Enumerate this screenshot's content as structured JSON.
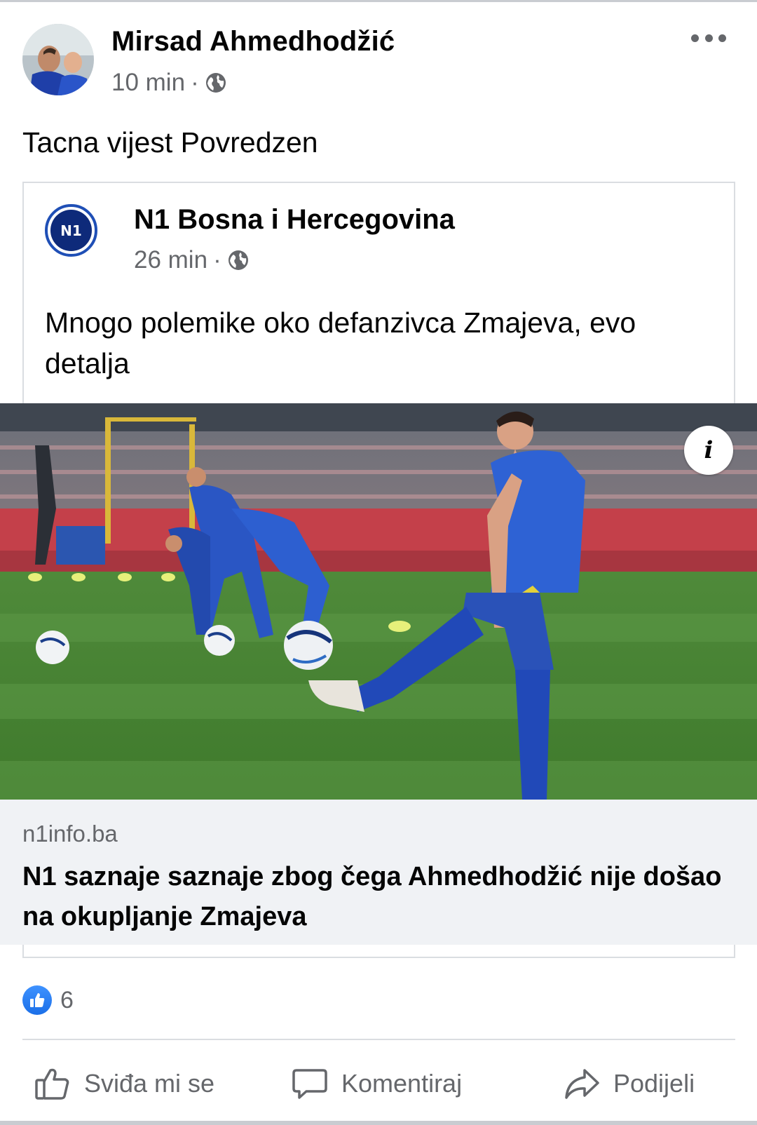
{
  "post": {
    "author": "Mirsad Ahmedhodžić",
    "time": "10 min",
    "separator": "·",
    "privacy_icon": "globe-icon",
    "text": "Tacna vijest Povredzen"
  },
  "shared_post": {
    "author": "N1 Bosna i Hercegovina",
    "logo_text": "N1",
    "time": "26 min",
    "separator": "·",
    "privacy_icon": "globe-icon",
    "text": "Mnogo polemike oko defanzivca Zmajeva, evo detalja"
  },
  "link_preview": {
    "info_label": "i",
    "domain": "n1info.ba",
    "title": "N1 saznaje saznaje zbog čega Ahmedhodžić nije došao na okupljanje Zmajeva"
  },
  "reactions": {
    "icon": "thumbs-up-icon",
    "count": "6"
  },
  "actions": {
    "like_label": "Sviđa mi se",
    "comment_label": "Komentiraj",
    "share_label": "Podijeli"
  },
  "colors": {
    "text_primary": "#050505",
    "text_secondary": "#65676b",
    "link_box_bg": "#f0f2f5",
    "like_blue": "#1b6fe8",
    "divider": "#dadde1"
  }
}
